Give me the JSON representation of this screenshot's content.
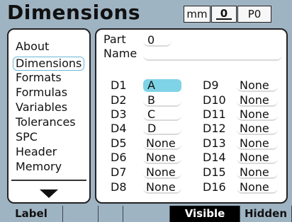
{
  "header": {
    "title": "Dimensions",
    "units": "mm",
    "axis_label": "0",
    "preset": "P0"
  },
  "sidebar": {
    "items": [
      "About",
      "Dimensions",
      "Formats",
      "Formulas",
      "Variables",
      "Tolerances",
      "SPC",
      "Header",
      "Memory"
    ],
    "selected": "Dimensions"
  },
  "content": {
    "part_label": "Part",
    "part_value": "0",
    "name_label": "Name",
    "name_value": "",
    "dimensions": [
      {
        "label": "D1",
        "value": "A"
      },
      {
        "label": "D2",
        "value": "B"
      },
      {
        "label": "D3",
        "value": "C"
      },
      {
        "label": "D4",
        "value": "D"
      },
      {
        "label": "D5",
        "value": "None"
      },
      {
        "label": "D6",
        "value": "None"
      },
      {
        "label": "D7",
        "value": "None"
      },
      {
        "label": "D8",
        "value": "None"
      },
      {
        "label": "D9",
        "value": "None"
      },
      {
        "label": "D10",
        "value": "None"
      },
      {
        "label": "D11",
        "value": "None"
      },
      {
        "label": "D12",
        "value": "None"
      },
      {
        "label": "D13",
        "value": "None"
      },
      {
        "label": "D14",
        "value": "None"
      },
      {
        "label": "D15",
        "value": "None"
      },
      {
        "label": "D16",
        "value": "None"
      }
    ],
    "selected_dimension": "D1"
  },
  "softkeys": [
    "Label",
    "",
    "",
    "",
    "Visible",
    "Hidden"
  ],
  "colors": {
    "background": "#9fb4c3",
    "selection": "#7fd3e6",
    "active_softkey": "#000000"
  }
}
